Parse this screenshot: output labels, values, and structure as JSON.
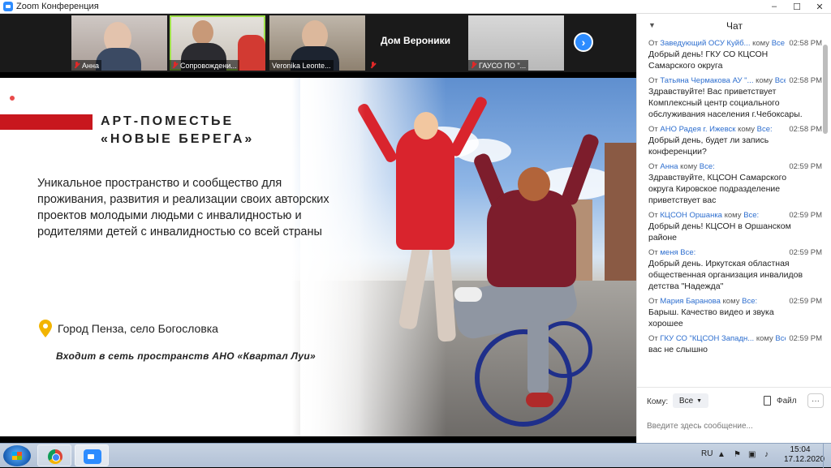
{
  "window": {
    "title": "Zoom Конференция",
    "minimize": "–",
    "maximize": "☐",
    "close": "✕"
  },
  "participants": [
    {
      "name": "Анна",
      "muted": true
    },
    {
      "name": "Сопровождени...",
      "muted": true,
      "active": true
    },
    {
      "name": "Veronika Leonte...",
      "muted": false
    },
    {
      "name": "Дом Вероники",
      "muted": true,
      "video_off": true
    },
    {
      "name": "ГАУСО ПО \"...",
      "muted": true
    }
  ],
  "next_page_icon": "›",
  "slide": {
    "title_line1": "АРТ-ПОМЕСТЬЕ",
    "title_line2": "«НОВЫЕ БЕРЕГА»",
    "subtitle": "Уникальное пространство и сообщество для проживания, развития и реализации своих авторских проектов молодыми людьми с инвалидностью и родителями детей с инвалидностью со всей страны",
    "location": "Город Пенза, село Богословка",
    "network": "Входит в сеть пространств АНО «Квартал Луи»"
  },
  "chat": {
    "title": "Чат",
    "messages": [
      {
        "from_label": "От",
        "sender": "Заведующий ОСУ Куйб...",
        "to_label": "кому",
        "recipient": "Все:",
        "time": "02:58 PM",
        "text": "Добрый день! ГКУ СО КЦСОН Самарского округа"
      },
      {
        "from_label": "От",
        "sender": "Татьяна Чермакова АУ \"...",
        "to_label": "кому",
        "recipient": "Все:",
        "time": "02:58 PM",
        "text": "Здравствуйте! Вас приветствует Комплексный центр социального обслуживания населения г.Чебоксары."
      },
      {
        "from_label": "От",
        "sender": "АНО Радея г. Ижевск",
        "to_label": "кому",
        "recipient": "Все:",
        "time": "02:58 PM",
        "text": "Добрый день, будет ли запись конференции?"
      },
      {
        "from_label": "От",
        "sender": "Анна",
        "to_label": "кому",
        "recipient": "Все:",
        "time": "02:59 PM",
        "text": "Здравствуйте, КЦСОН Самарского округа Кировское подразделение приветствует вас"
      },
      {
        "from_label": "От",
        "sender": "КЦСОН Оршанка",
        "to_label": "кому",
        "recipient": "Все:",
        "time": "02:59 PM",
        "text": "Добрый день! КЦСОН в Оршанском районе"
      },
      {
        "from_label": "От",
        "sender": "меня",
        "to_label": "",
        "recipient": "Все:",
        "time": "02:59 PM",
        "text": "Добрый день. Иркутская областная общественная организация инвалидов детства \"Надежда\""
      },
      {
        "from_label": "От",
        "sender": "Мария Баранова",
        "to_label": "кому",
        "recipient": "Все:",
        "time": "02:59 PM",
        "text": "Барыш. Качество видео и звука хорошее"
      },
      {
        "from_label": "От",
        "sender": "ГКУ СО \"КЦСОН Западн...",
        "to_label": "кому",
        "recipient": "Все:",
        "time": "02:59 PM",
        "text": "вас не слышно"
      }
    ],
    "to_label": "Кому:",
    "to_value": "Все",
    "file_label": "Файл",
    "more_label": "···",
    "input_placeholder": "Введите здесь сообщение..."
  },
  "taskbar": {
    "language": "RU",
    "time": "15:04",
    "date": "17.12.2020"
  }
}
